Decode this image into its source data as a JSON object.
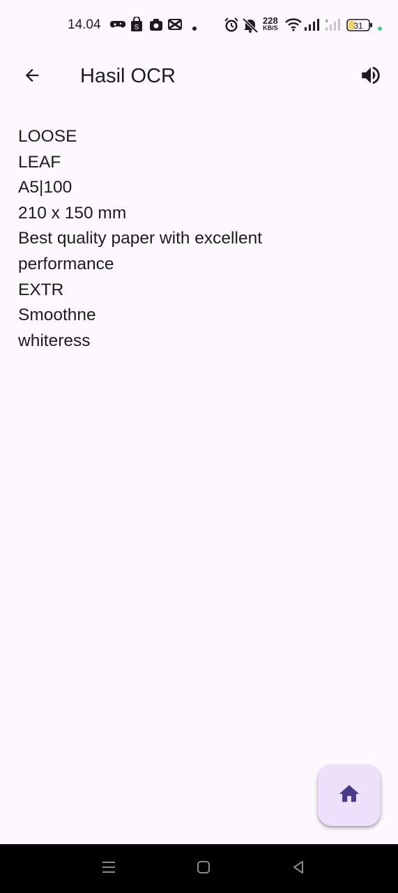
{
  "status_bar": {
    "time": "14.04",
    "network_speed": "228",
    "network_speed_unit": "KB/S",
    "battery": "31",
    "icons": [
      "game-controller-icon",
      "shopping-bag-icon",
      "camera-icon",
      "capcut-icon",
      "dot-icon",
      "alarm-icon",
      "mute-icon",
      "wifi-icon",
      "signal-icon",
      "battery-icon"
    ]
  },
  "app_bar": {
    "title": "Hasil OCR",
    "back_icon": "arrow-back-icon",
    "speak_icon": "volume-up-icon"
  },
  "ocr_lines": [
    "LOOSE",
    "LEAF",
    "A5|100",
    "210 x 150 mm",
    "Best quality paper with excellent",
    "performance",
    "EXTR",
    "Smoothne",
    "whiteress"
  ],
  "fab": {
    "icon": "home-icon"
  },
  "nav_bar": {
    "icons": [
      "menu-icon",
      "home-square-icon",
      "back-triangle-icon"
    ]
  },
  "colors": {
    "background": "#fdf7fe",
    "text": "#1d1b20",
    "fab_background": "#ece0fb",
    "fab_icon": "#4a3a8c",
    "nav_background": "#000000",
    "battery_dot": "#3fcf7f"
  }
}
